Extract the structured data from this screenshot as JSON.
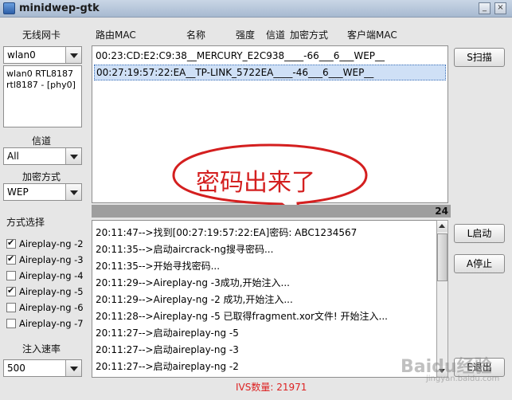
{
  "window": {
    "title": "minidwep-gtk",
    "minimize_label": "_",
    "close_label": "×"
  },
  "left": {
    "adapter_label": "无线网卡",
    "adapter_value": "wlan0",
    "adapter_info": [
      "wlan0 RTL8187",
      "rtl8187 - [phy0]"
    ],
    "channel_label": "信道",
    "channel_value": "All",
    "encryption_label": "加密方式",
    "encryption_value": "WEP",
    "method_label": "方式选择",
    "methods": [
      {
        "label": "Aireplay-ng -2",
        "checked": true
      },
      {
        "label": "Aireplay-ng -3",
        "checked": true
      },
      {
        "label": "Aireplay-ng -4",
        "checked": false
      },
      {
        "label": "Aireplay-ng -5",
        "checked": true
      },
      {
        "label": "Aireplay-ng -6",
        "checked": false
      },
      {
        "label": "Aireplay-ng -7",
        "checked": false
      }
    ],
    "rate_label": "注入速率",
    "rate_value": "500"
  },
  "headers": [
    "路由MAC",
    "名称",
    "强度",
    "信道",
    "加密方式",
    "客户端MAC"
  ],
  "ap_rows": [
    "00:23:CD:E2:C9:38__MERCURY_E2C938____-66___6___WEP__",
    "00:27:19:57:22:EA__TP-LINK_5722EA____-46___6___WEP__"
  ],
  "progress_count": "24",
  "log_lines": [
    "20:11:47-->找到[00:27:19:57:22:EA]密码: ABC1234567",
    "20:11:35-->启动aircrack-ng搜寻密码...",
    "20:11:35-->开始寻找密码...",
    "20:11:29-->Aireplay-ng -3成功,开始注入...",
    "20:11:29-->Aireplay-ng -2 成功,开始注入...",
    "20:11:28-->Aireplay-ng -5 已取得fragment.xor文件! 开始注入...",
    "20:11:27-->启动aireplay-ng -5",
    "20:11:27-->启动aireplay-ng -3",
    "20:11:27-->启动aireplay-ng -2"
  ],
  "buttons": {
    "scan": "S扫描",
    "start": "L启动",
    "stop": "A停止",
    "exit": "E退出"
  },
  "ivs_label": "IVS数量: 21971",
  "annotation": "密码出来了",
  "watermark": {
    "brand": "Baidu经验",
    "url": "jingyan.baidu.com"
  },
  "colors": {
    "selection": "#cfe0f6",
    "annotation": "#d41f1f",
    "ivs": "#dd2222"
  }
}
